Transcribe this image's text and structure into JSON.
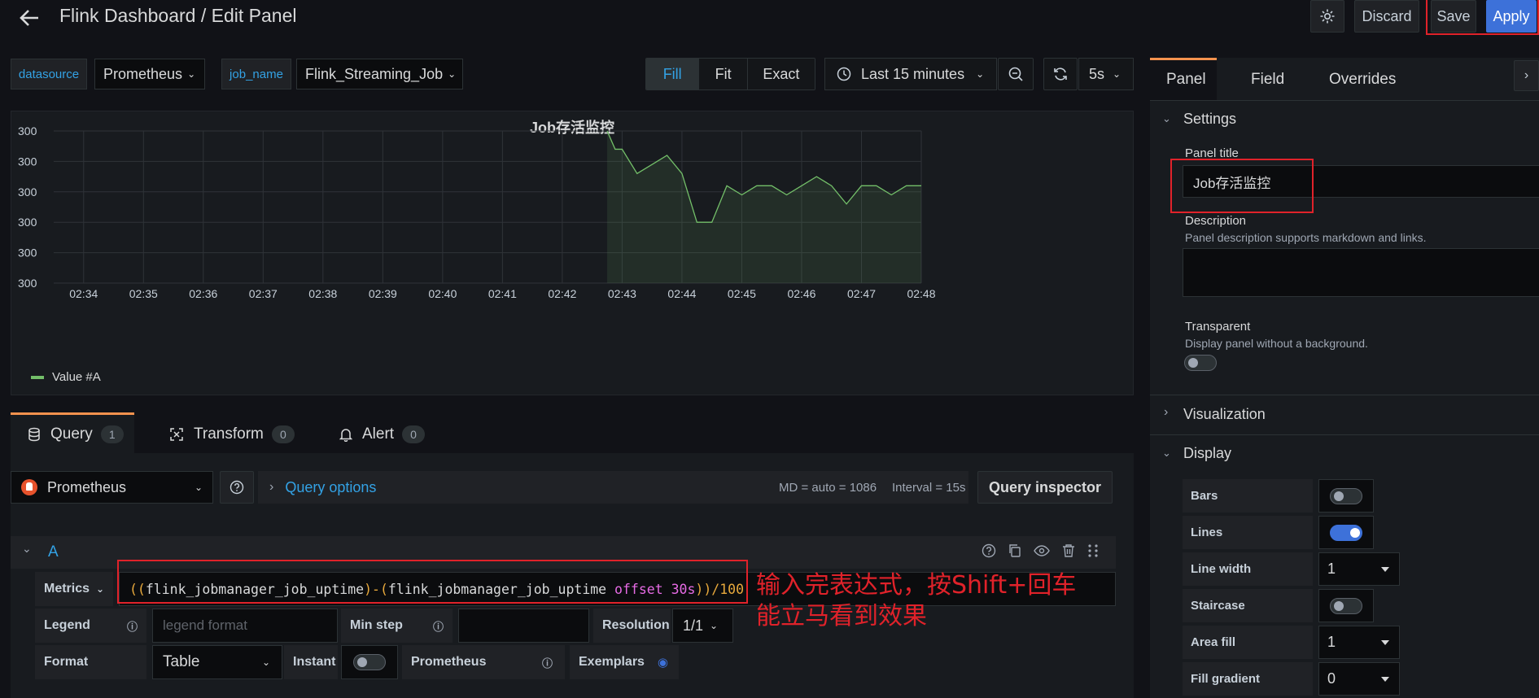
{
  "header": {
    "title": "Flink Dashboard / Edit Panel",
    "discard_label": "Discard",
    "save_label": "Save",
    "apply_label": "Apply"
  },
  "variables": {
    "datasource_label": "datasource",
    "datasource_value": "Prometheus",
    "job_name_label": "job_name",
    "job_name_value": "Flink_Streaming_Job"
  },
  "view_modes": [
    "Fill",
    "Fit",
    "Exact"
  ],
  "time_range": "Last 15 minutes",
  "refresh_interval": "5s",
  "panel": {
    "title": "Job存活监控",
    "legend": "Value #A"
  },
  "chart_data": {
    "type": "area",
    "title": "Job存活监控",
    "x_ticks": [
      "02:34",
      "02:35",
      "02:36",
      "02:37",
      "02:38",
      "02:39",
      "02:40",
      "02:41",
      "02:42",
      "02:43",
      "02:44",
      "02:45",
      "02:46",
      "02:47",
      "02:48"
    ],
    "y_ticks": [
      "300",
      "300",
      "300",
      "300",
      "300",
      "300"
    ],
    "series": [
      {
        "name": "Value #A",
        "color": "#73bf69",
        "x": [
          "02:42:45",
          "02:42:53",
          "02:43:00",
          "02:43:15",
          "02:43:30",
          "02:43:45",
          "02:44:00",
          "02:44:15",
          "02:44:30",
          "02:44:45",
          "02:45:00",
          "02:45:15",
          "02:45:30",
          "02:45:45",
          "02:46:00",
          "02:46:15",
          "02:46:30",
          "02:46:45",
          "02:47:00",
          "02:47:15",
          "02:47:30",
          "02:47:45",
          "02:48:00"
        ],
        "y": [
          5.0,
          4.4,
          4.4,
          3.6,
          3.9,
          4.2,
          3.6,
          2.0,
          2.0,
          3.2,
          2.9,
          3.2,
          3.2,
          2.9,
          3.2,
          3.5,
          3.2,
          2.6,
          3.2,
          3.2,
          2.9,
          3.2,
          3.2
        ],
        "y_note_unused": ""
      }
    ]
  },
  "query_tabs": [
    {
      "label": "Query",
      "count": "1"
    },
    {
      "label": "Transform",
      "count": "0"
    },
    {
      "label": "Alert",
      "count": "0"
    }
  ],
  "query": {
    "datasource": "Prometheus",
    "query_options_label": "Query options",
    "md_info": "MD = auto = 1086",
    "interval_info": "Interval = 15s",
    "inspector_label": "Query inspector",
    "row_label": "A",
    "metrics_label": "Metrics",
    "expression_parts": [
      "((",
      "flink_jobmanager_job_uptime",
      ")-(",
      "flink_jobmanager_job_uptime",
      " offset ",
      "30s",
      "))/100"
    ],
    "legend_label": "Legend",
    "legend_placeholder": "legend format",
    "min_step_label": "Min step",
    "resolution_label": "Resolution",
    "resolution_value": "1/1",
    "format_label": "Format",
    "format_value": "Table",
    "instant_label": "Instant",
    "prometheus_label": "Prometheus",
    "exemplars_label": "Exemplars"
  },
  "annotation": {
    "line1": "输入完表达式，按Shift+回车",
    "line2": "能立马看到效果"
  },
  "options_pane": {
    "tabs": [
      "Panel",
      "Field",
      "Overrides"
    ],
    "settings_title": "Settings",
    "panel_title_label": "Panel title",
    "panel_title_value": "Job存活监控",
    "description_label": "Description",
    "description_hint": "Panel description supports markdown and links.",
    "transparent_label": "Transparent",
    "transparent_hint": "Display panel without a background.",
    "visualization_title": "Visualization",
    "display_title": "Display",
    "display_rows": [
      {
        "label": "Bars",
        "kind": "toggle",
        "on": false
      },
      {
        "label": "Lines",
        "kind": "toggle",
        "on": true
      },
      {
        "label": "Line width",
        "kind": "select",
        "value": "1"
      },
      {
        "label": "Staircase",
        "kind": "toggle",
        "on": false
      },
      {
        "label": "Area fill",
        "kind": "select",
        "value": "1"
      },
      {
        "label": "Fill gradient",
        "kind": "select",
        "value": "0"
      }
    ]
  }
}
